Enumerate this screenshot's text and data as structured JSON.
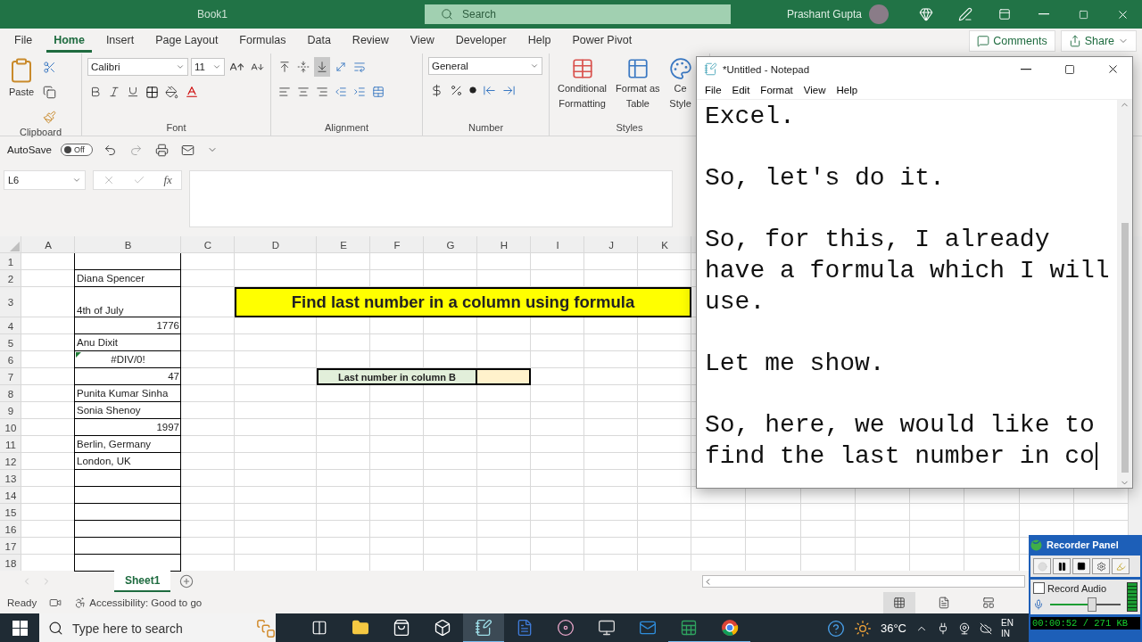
{
  "excel": {
    "title": "Book1",
    "search": {
      "placeholder": "Search"
    },
    "user": "Prashant Gupta",
    "tabs": [
      {
        "label": "File",
        "selected": false
      },
      {
        "label": "Home",
        "selected": true
      },
      {
        "label": "Insert",
        "selected": false
      },
      {
        "label": "Page Layout",
        "selected": false
      },
      {
        "label": "Formulas",
        "selected": false
      },
      {
        "label": "Data",
        "selected": false
      },
      {
        "label": "Review",
        "selected": false
      },
      {
        "label": "View",
        "selected": false
      },
      {
        "label": "Developer",
        "selected": false
      },
      {
        "label": "Help",
        "selected": false
      },
      {
        "label": "Power Pivot",
        "selected": false
      }
    ],
    "comments": "Comments",
    "share": "Share",
    "ribbon": {
      "clipboard": {
        "label": "Clipboard",
        "paste": "Paste"
      },
      "font": {
        "label": "Font",
        "family": "Calibri",
        "size": "11"
      },
      "alignment": {
        "label": "Alignment"
      },
      "number": {
        "label": "Number",
        "format": "General"
      },
      "styles": {
        "label": "Styles",
        "buttons": [
          {
            "kind": "conditional",
            "lines": [
              "Conditional",
              "Formatting"
            ]
          },
          {
            "kind": "table",
            "lines": [
              "Format as",
              "Table"
            ]
          },
          {
            "kind": "cell",
            "lines": [
              "Ce",
              "Style"
            ]
          }
        ]
      }
    },
    "quick_access": {
      "autosave": "AutoSave",
      "autosave_on": false,
      "toggle_text": "Off"
    },
    "formula_bar": {
      "name_box": "L6",
      "fx": "fx"
    },
    "columns": [
      "A",
      "B",
      "C",
      "D",
      "E",
      "F",
      "G",
      "H",
      "I",
      "J",
      "K"
    ],
    "rows": [
      "1",
      "2",
      "3",
      "4",
      "5",
      "6",
      "7",
      "8",
      "9",
      "10",
      "11",
      "12",
      "13",
      "14",
      "15",
      "16",
      "17",
      "18"
    ],
    "column_b": [
      {
        "kind": "empty"
      },
      {
        "kind": "text",
        "text": "Diana Spencer"
      },
      {
        "kind": "text",
        "text": "4th of July"
      },
      {
        "kind": "number",
        "text": "1776"
      },
      {
        "kind": "text",
        "text": "Anu Dixit"
      },
      {
        "kind": "error",
        "text": "#DIV/0!"
      },
      {
        "kind": "number",
        "text": "47"
      },
      {
        "kind": "text",
        "text": "Punita Kumar Sinha"
      },
      {
        "kind": "text",
        "text": "Sonia Shenoy"
      },
      {
        "kind": "number",
        "text": "1997"
      },
      {
        "kind": "text",
        "text": "Berlin, Germany"
      },
      {
        "kind": "text",
        "text": "London, UK"
      },
      {
        "kind": "empty"
      },
      {
        "kind": "empty"
      },
      {
        "kind": "empty"
      },
      {
        "kind": "empty"
      },
      {
        "kind": "empty"
      },
      {
        "kind": "empty"
      }
    ],
    "banner": "Find last number in a column using formula",
    "lookup": {
      "label": "Last number in column B"
    },
    "sheets": [
      {
        "label": "Sheet1",
        "selected": true
      }
    ],
    "status": {
      "mode": "Ready",
      "accessibility": "Accessibility: Good to go"
    }
  },
  "notepad": {
    "title": "*Untitled - Notepad",
    "menu": [
      "File",
      "Edit",
      "Format",
      "View",
      "Help"
    ],
    "text": "Excel.\n\nSo, let's do it.\n\nSo, for this, I already\nhave a formula which I will\nuse.\n\nLet me show.\n\nSo, here, we would like to\nfind the last number in co"
  },
  "taskbar": {
    "search_placeholder": "Type here to search",
    "apps": [
      {
        "kind": "taskview",
        "selected": false,
        "running": false
      },
      {
        "kind": "explorer",
        "selected": false,
        "running": false
      },
      {
        "kind": "store",
        "selected": false,
        "running": false
      },
      {
        "kind": "dropbox",
        "selected": false,
        "running": false
      },
      {
        "kind": "notepad",
        "selected": true,
        "running": true
      },
      {
        "kind": "word",
        "selected": false,
        "running": false
      },
      {
        "kind": "disc",
        "selected": false,
        "running": false
      },
      {
        "kind": "remote",
        "selected": false,
        "running": false
      },
      {
        "kind": "outlook",
        "selected": false,
        "running": false
      },
      {
        "kind": "excel",
        "selected": false,
        "running": true
      },
      {
        "kind": "chrome",
        "selected": false,
        "running": true
      }
    ],
    "temperature": "36°C",
    "language": [
      "EN",
      "IN"
    ]
  },
  "recorder": {
    "title": "Recorder Panel",
    "record_audio": false,
    "audio_label": "Record Audio",
    "level": 0.6,
    "readout": "00:00:52 / 271 KB"
  }
}
